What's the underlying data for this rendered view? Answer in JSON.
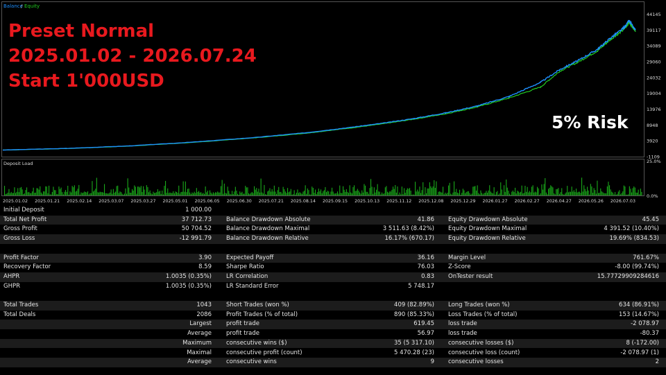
{
  "legend": {
    "balance": "Balance",
    "sep": "/",
    "equity": "Equity"
  },
  "overlay": {
    "line1": "Preset Normal",
    "line2": "2025.01.02 - 2026.07.24",
    "line3": "Start 1'000USD",
    "risk": "5% Risk"
  },
  "deposit_label": "Deposit Load",
  "colors": {
    "balance": "#1e90ff",
    "equity": "#22cc22",
    "load": "#1aa81a",
    "overlay_text": "#e8191e"
  },
  "chart_data": [
    {
      "type": "line",
      "series": [
        {
          "name": "Balance",
          "x": [
            0,
            10,
            20,
            30,
            40,
            48,
            55,
            60,
            65,
            70,
            75,
            80,
            85,
            88,
            91,
            94,
            96,
            98,
            99,
            100
          ],
          "values": [
            1000,
            1500,
            2300,
            3500,
            5000,
            6500,
            8200,
            9500,
            11000,
            12800,
            15000,
            18000,
            22500,
            26500,
            29500,
            33000,
            36500,
            39500,
            42000,
            39000
          ]
        },
        {
          "name": "Equity",
          "x": [
            0,
            10,
            20,
            30,
            40,
            48,
            55,
            60,
            65,
            70,
            75,
            80,
            85,
            88,
            91,
            94,
            96,
            98,
            99,
            100
          ],
          "values": [
            1000,
            1450,
            2250,
            3400,
            4900,
            6350,
            8000,
            9300,
            10800,
            12500,
            14700,
            17500,
            21000,
            26000,
            29000,
            32500,
            36000,
            39000,
            41500,
            38800
          ]
        }
      ],
      "ylim": [
        -1109,
        46000
      ],
      "yticks": [
        "44145",
        "39117",
        "34089",
        "29060",
        "24032",
        "19004",
        "13976",
        "8948",
        "3920",
        "-1109"
      ]
    },
    {
      "type": "bar",
      "title": "Deposit Load",
      "ylim": [
        0,
        25
      ],
      "yticks": [
        "25.0%",
        "0.0%"
      ],
      "xticks": [
        "2025.01.02",
        "2025.01.21",
        "2025.02.14",
        "2025.03.07",
        "2025.03.27",
        "2025.05.01",
        "2025.06.05",
        "2025.06.30",
        "2025.07.21",
        "2025.08.14",
        "2025.09.15",
        "2025.10.13",
        "2025.11.12",
        "2025.12.08",
        "2025.12.29",
        "2026.01.27",
        "2026.02.27",
        "2026.04.27",
        "2026.05.26",
        "2026.07.03"
      ]
    }
  ],
  "report": {
    "initial_deposit": {
      "label": "Initial Deposit",
      "value": "1 000.00"
    },
    "rows1": [
      {
        "l1": "Total Net Profit",
        "v1": "37 712.73",
        "l2": "Balance Drawdown Absolute",
        "v2": "41.86",
        "l3": "Equity Drawdown Absolute",
        "v3": "45.45"
      },
      {
        "l1": "Gross Profit",
        "v1": "50 704.52",
        "l2": "Balance Drawdown Maximal",
        "v2": "3 511.63 (8.42%)",
        "l3": "Equity Drawdown Maximal",
        "v3": "4 391.52 (10.40%)"
      },
      {
        "l1": "Gross Loss",
        "v1": "-12 991.79",
        "l2": "Balance Drawdown Relative",
        "v2": "16.17% (670.17)",
        "l3": "Equity Drawdown Relative",
        "v3": "19.69% (834.53)"
      }
    ],
    "rows2": [
      {
        "l1": "Profit Factor",
        "v1": "3.90",
        "l2": "Expected Payoff",
        "v2": "36.16",
        "l3": "Margin Level",
        "v3": "761.67%"
      },
      {
        "l1": "Recovery Factor",
        "v1": "8.59",
        "l2": "Sharpe Ratio",
        "v2": "76.03",
        "l3": "Z-Score",
        "v3": "-8.00 (99.74%)"
      },
      {
        "l1": "AHPR",
        "v1": "1.0035 (0.35%)",
        "l2": "LR Correlation",
        "v2": "0.83",
        "l3": "OnTester result",
        "v3": "15.77729909284616"
      },
      {
        "l1": "GHPR",
        "v1": "1.0035 (0.35%)",
        "l2": "LR Standard Error",
        "v2": "5 748.17",
        "l3": "",
        "v3": ""
      }
    ],
    "rows3": [
      {
        "l1": "Total Trades",
        "v1": "1043",
        "l2": "Short Trades (won %)",
        "v2": "409 (82.89%)",
        "l3": "Long Trades (won %)",
        "v3": "634 (86.91%)"
      },
      {
        "l1": "Total Deals",
        "v1": "2086",
        "l2": "Profit Trades (% of total)",
        "v2": "890 (85.33%)",
        "l3": "Loss Trades (% of total)",
        "v3": "153 (14.67%)"
      },
      {
        "l1": "Largest",
        "v1": "",
        "l2": "profit trade",
        "v2": "619.45",
        "l3": "loss trade",
        "v3": "-2 078.97"
      },
      {
        "l1": "Average",
        "v1": "",
        "l2": "profit trade",
        "v2": "56.97",
        "l3": "loss trade",
        "v3": "-80.37"
      },
      {
        "l1": "Maximum",
        "v1": "",
        "l2": "consecutive wins ($)",
        "v2": "35 (5 317.10)",
        "l3": "consecutive losses ($)",
        "v3": "8 (-172.00)"
      },
      {
        "l1": "Maximal",
        "v1": "",
        "l2": "consecutive profit (count)",
        "v2": "5 470.28 (23)",
        "l3": "consecutive loss (count)",
        "v3": "-2 078.97 (1)"
      },
      {
        "l1": "Average",
        "v1": "",
        "l2": "consecutive wins",
        "v2": "9",
        "l3": "consecutive losses",
        "v3": "2"
      }
    ]
  }
}
